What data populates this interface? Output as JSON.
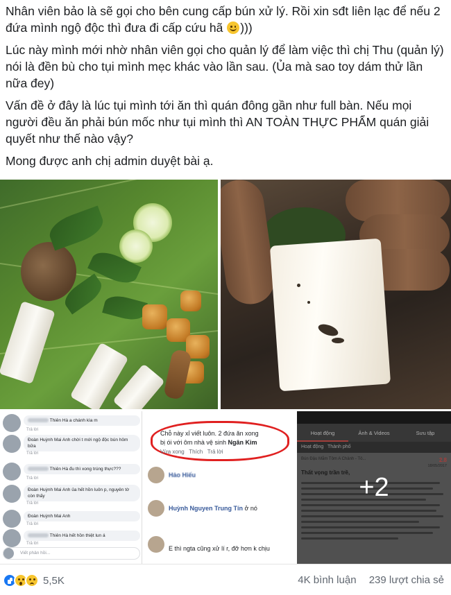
{
  "post": {
    "paragraphs": [
      {
        "text_before": "Nhân viên bảo là sẽ gọi cho bên cung cấp bún xử lý. Rồi xin sđt liên lạc để nếu 2 đứa mình ngộ độc thì đưa đi cấp cứu hã ",
        "emoji": "smiley-emoji",
        "text_after": ")))"
      },
      {
        "text": "Lúc này mình mới nhờ nhân viên gọi cho quản lý để làm việc thì chị Thu (quản lý) nói là đền bù cho tụi mình mẹc khác vào lần sau. (Ủa mà sao toy dám thử lần nữa đey)"
      },
      {
        "text": "Vấn đề ở đây là lúc tụi mình tới ăn thì quán đông gần như full bàn. Nếu mọi người đều ăn phải bún mốc như tụi mình thì AN TOÀN THỰC PHẨM quán giải quyết như thế nào vậy?"
      },
      {
        "text": "Mong được anh chị admin duyệt bài ạ."
      }
    ]
  },
  "media": {
    "comments_left": {
      "rows": [
        {
          "text": "Thiên Hà a chánh kìa m",
          "reply": "Trả lời"
        },
        {
          "text": "Đoàn Huỳnh Mai Anh chời t mới ngộ độc bún hôm bữa",
          "reply": "Trả lời"
        },
        {
          "text": "Thiên Hà đu thì xong trúng thực???",
          "reply": "Trả lời"
        },
        {
          "text": "Đoàn Huỳnh Mai Anh ủa hết hồn luôn p, nguyên tờ còn thấy",
          "reply": "Trả lời"
        },
        {
          "text": "Đoàn Huỳnh Mai Anh",
          "reply": "Trả lời"
        },
        {
          "text": "Thiên Hà hết hồn thiệt lun á",
          "reply": "Trả lời"
        }
      ],
      "input_placeholder": "Viết phản hồi..."
    },
    "comments_mid": {
      "circled_line1": "Chỗ này xỉ viết luôn. 2 đứa ăn xong",
      "circled_line2": "bị ói với ôm nhà vệ sinh",
      "circled_tag": "Ngân Kim",
      "meta": [
        "Vừa xong",
        "Thích",
        "Trả lời"
      ],
      "row2_name": "Hảo Hiếu",
      "row3_name": "Huỳnh Nguyen Trung Tín",
      "row3_text": "ở nó",
      "row4_text": "E thì ngta cũng xử lí r, đỡ hơn k chịu"
    },
    "app": {
      "tabs": [
        "Hoạt động",
        "Ảnh & Videos",
        "Sưu tập"
      ],
      "sub": [
        "Hoạt động",
        "Thành phố"
      ],
      "place": "Bún Đậu Mắm Tôm A Chảnh - Tô...",
      "rating": "2.8",
      "date": "18/05/2017",
      "title": "Thất vọng trần trề,",
      "more_count": "+2"
    }
  },
  "footer": {
    "reaction_count": "5,5K",
    "comments": "4K bình luận",
    "shares": "239 lượt chia sẻ"
  },
  "colors": {
    "text": "#1c1e21",
    "muted": "#606770",
    "link": "#365899",
    "like_blue": "#1877f2",
    "circle_red": "#e02020"
  }
}
